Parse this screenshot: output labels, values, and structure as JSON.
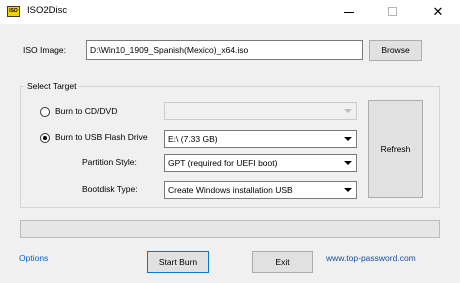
{
  "window": {
    "title": "ISO2Disc",
    "icon_text": "ISO",
    "minimize": "minimize",
    "maximize": "maximize",
    "close": "✕"
  },
  "iso": {
    "label": "ISO Image:",
    "path": "D:\\Win10_1909_Spanish(Mexico)_x64.iso",
    "browse_label": "Browse"
  },
  "target": {
    "group_label": "Select Target",
    "cd_dvd": {
      "label": "Burn to CD/DVD",
      "selected": false,
      "value": ""
    },
    "usb": {
      "label": "Burn to USB Flash Drive",
      "selected": true,
      "value": "E:\\ (7.33 GB)"
    },
    "partition_style": {
      "label": "Partition Style:",
      "value": "GPT (required for UEFI boot)"
    },
    "bootdisk_type": {
      "label": "Bootdisk Type:",
      "value": "Create Windows installation USB"
    },
    "refresh_label": "Refresh"
  },
  "progress": {
    "value": 0
  },
  "footer": {
    "options_label": "Options",
    "start_burn_label": "Start Burn",
    "exit_label": "Exit",
    "website": "www.top-password.com"
  }
}
